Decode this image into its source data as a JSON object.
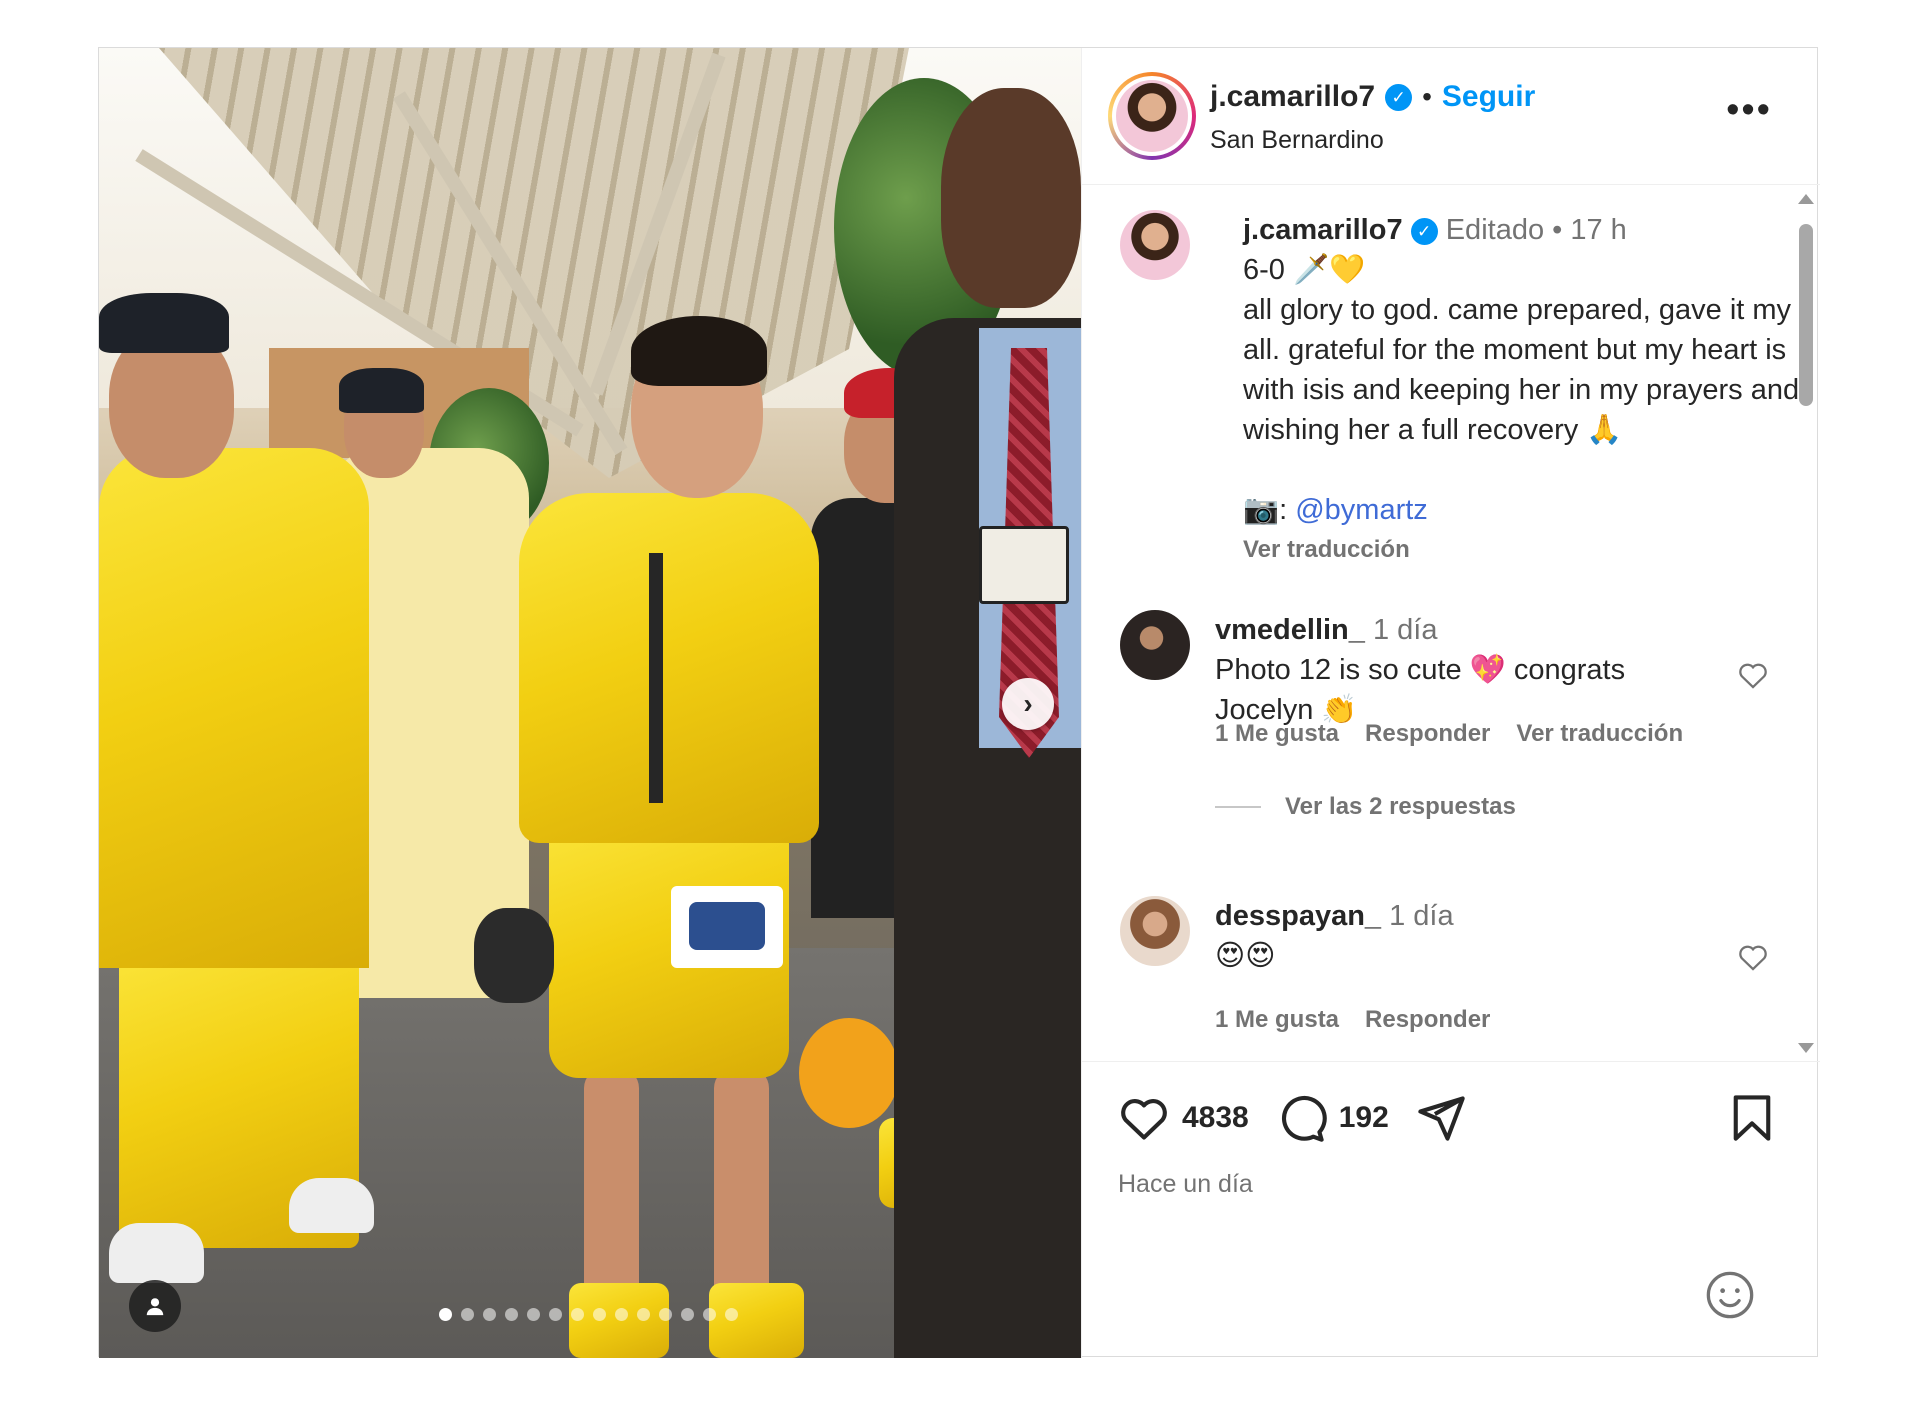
{
  "post": {
    "author": "j.camarillo7",
    "follow_label": "Seguir",
    "separator": "•",
    "location": "San Bernardino",
    "more_label": "•••",
    "media": {
      "slide_count": 14,
      "active_slide": 1,
      "next_label": "›"
    }
  },
  "caption": {
    "username": "j.camarillo7",
    "edited": "Editado",
    "dot": "•",
    "time": "17 h",
    "line1": "6-0 🗡️💛",
    "body": "all glory to god. came prepared, gave it my all. grateful for the moment but my heart is with isis and keeping her in my prayers and wishing her a full recovery 🙏",
    "credit_prefix": "📷: ",
    "credit_link": "@bymartz",
    "translate": "Ver traducción"
  },
  "comments": [
    {
      "username": "vmedellin_",
      "time": "1 día",
      "text": "Photo 12 is so cute 💖 congrats Jocelyn 👏",
      "likes": "1 Me gusta",
      "reply": "Responder",
      "translate": "Ver traducción",
      "replies": "Ver las 2 respuestas"
    },
    {
      "username": "desspayan_",
      "time": "1 día",
      "text": "😍😍",
      "likes": "1 Me gusta",
      "reply": "Responder"
    }
  ],
  "actions": {
    "likes_count": "4838",
    "comments_count": "192",
    "posted": "Hace un día"
  },
  "colors": {
    "accent": "#0095f6",
    "secondary_text": "#737373",
    "link": "#3f6bd6"
  },
  "icons": [
    "verified-badge-icon",
    "more-icon",
    "heart-icon",
    "comment-icon",
    "share-icon",
    "bookmark-icon",
    "emoji-icon",
    "user-tag-icon",
    "chevron-right-icon"
  ]
}
